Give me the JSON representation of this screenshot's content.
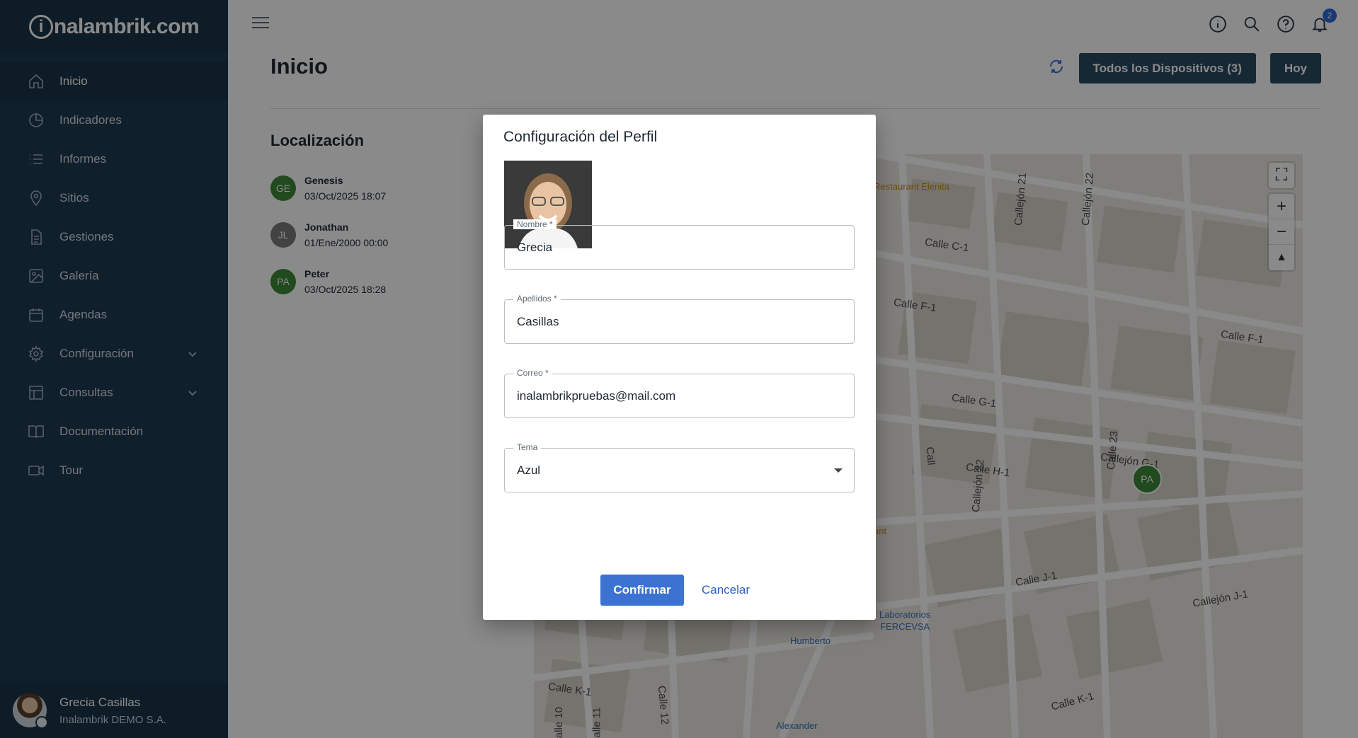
{
  "sidebar": {
    "logo_text": "nalambrik.com",
    "logo_letter": "i",
    "items": [
      {
        "label": "Inicio",
        "icon": "home-icon"
      },
      {
        "label": "Indicadores",
        "icon": "pie-chart-icon"
      },
      {
        "label": "Informes",
        "icon": "list-icon"
      },
      {
        "label": "Sitios",
        "icon": "map-pin-icon"
      },
      {
        "label": "Gestiones",
        "icon": "document-icon"
      },
      {
        "label": "Galería",
        "icon": "image-icon"
      },
      {
        "label": "Agendas",
        "icon": "calendar-icon"
      },
      {
        "label": "Configuración",
        "icon": "gear-icon"
      },
      {
        "label": "Consultas",
        "icon": "table-icon"
      },
      {
        "label": "Documentación",
        "icon": "book-icon"
      },
      {
        "label": "Tour",
        "icon": "video-icon"
      }
    ],
    "user": {
      "name": "Grecia Casillas",
      "org": "Inalambrik DEMO S.A."
    }
  },
  "topbar": {
    "notification_count": "2"
  },
  "page": {
    "title": "Inicio",
    "devices_button": "Todos los Dispositivos (3)",
    "today_button": "Hoy",
    "localization_title": "Localización",
    "locations": [
      {
        "initials": "GE",
        "name": "Genesis",
        "date": "03/Oct/2025 18:07",
        "color": "#3e8a3a"
      },
      {
        "initials": "JL",
        "name": "Jonathan",
        "date": "01/Ene/2000 00:00",
        "color": "#7a7a7a"
      },
      {
        "initials": "PA",
        "name": "Peter",
        "date": "03/Oct/2025 18:28",
        "color": "#3e8a3a"
      }
    ]
  },
  "map": {
    "streets": [
      "Calle C-1",
      "Calle F-1",
      "Calle F-1",
      "Calle G-1",
      "Calle H-1",
      "Callejón G-1",
      "Calle J-1",
      "Callejón J-1",
      "Calle K-1",
      "Calle K-1",
      "Callejón 21",
      "Callejón 22",
      "Callejón 22",
      "Calle 23",
      "Calle 12",
      "Calle 10",
      "Calle 11",
      "Call"
    ],
    "pois": {
      "restaurant": "Restaurant Elenita",
      "lab_line1": "Laboratorios",
      "lab_line2": "FERCEVSA",
      "humberto": "Humberto",
      "alexander": "Alexander",
      "partial_ant": "ant"
    },
    "marker": "PA"
  },
  "dialog": {
    "title": "Configuración del Perfil",
    "fields": {
      "nombre": {
        "label": "Nombre *",
        "value": "Grecia"
      },
      "apellidos": {
        "label": "Apellidos *",
        "value": "Casillas"
      },
      "correo": {
        "label": "Correo *",
        "value": "inalambrikpruebas@mail.com"
      },
      "tema": {
        "label": "Tema",
        "value": "Azul"
      }
    },
    "confirm": "Confirmar",
    "cancel": "Cancelar"
  }
}
